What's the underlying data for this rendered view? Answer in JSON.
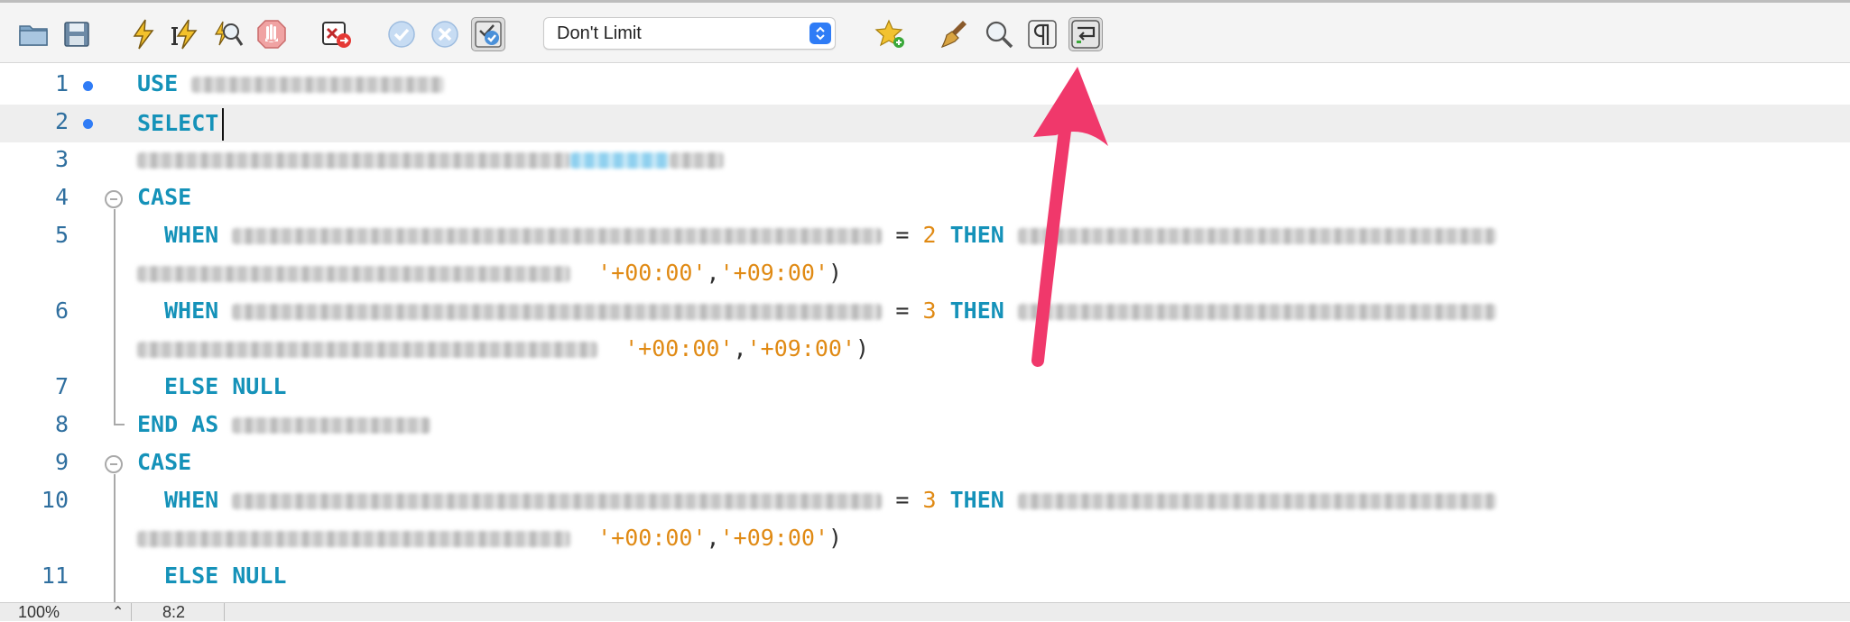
{
  "toolbar": {
    "buttons": [
      {
        "name": "open-folder-icon"
      },
      {
        "name": "save-icon"
      },
      {
        "name": "execute-all-icon"
      },
      {
        "name": "execute-current-icon"
      },
      {
        "name": "explain-icon"
      },
      {
        "name": "stop-icon"
      },
      {
        "name": "toggle-continue-on-error-icon"
      },
      {
        "name": "commit-icon"
      },
      {
        "name": "rollback-icon"
      },
      {
        "name": "autocommit-icon"
      },
      {
        "name": "add-snippet-icon"
      },
      {
        "name": "beautify-icon"
      },
      {
        "name": "find-icon"
      },
      {
        "name": "invisible-characters-icon"
      },
      {
        "name": "word-wrap-icon"
      }
    ],
    "limit_select_value": "Don't Limit"
  },
  "editor": {
    "lines": [
      {
        "num": "1",
        "modified": true
      },
      {
        "num": "2",
        "modified": true,
        "current": true
      },
      {
        "num": "3"
      },
      {
        "num": "4",
        "fold": true
      },
      {
        "num": "5"
      },
      {
        "num": ""
      },
      {
        "num": "6"
      },
      {
        "num": ""
      },
      {
        "num": "7"
      },
      {
        "num": "8"
      },
      {
        "num": "9",
        "fold": true
      },
      {
        "num": "10"
      },
      {
        "num": ""
      },
      {
        "num": "11"
      }
    ],
    "kw": {
      "use": "USE",
      "select": "SELECT",
      "case": "CASE",
      "when": "WHEN",
      "then": "THEN",
      "else_null": "ELSE NULL",
      "end_as": "END AS"
    },
    "tokens": {
      "eq": "=",
      "num_2": "2",
      "num_3": "3",
      "tz_from": "'+00:00'",
      "comma": ",",
      "tz_to": "'+09:00'",
      "paren": ")"
    }
  },
  "status": {
    "zoom": "100%",
    "zoom_stepper": "⌃",
    "cursor_pos": "8:2"
  },
  "colors": {
    "keyword": "#1592b9",
    "literal": "#e08a14",
    "line_number": "#2f6f9f",
    "marker": "#2f7cf6",
    "arrow": "#f0386b"
  }
}
